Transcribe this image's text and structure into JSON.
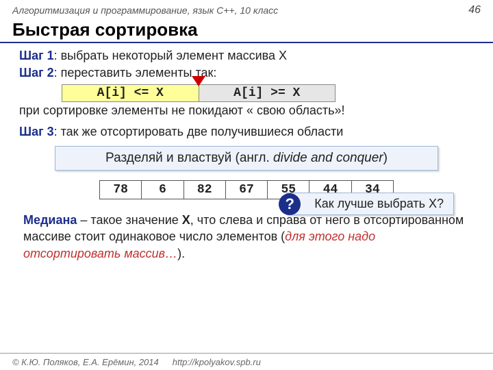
{
  "header": {
    "course": "Алгоритмизация и программирование, язык C++, 10 класс",
    "page": "46"
  },
  "title": "Быстрая сортировка",
  "step1": {
    "label": "Шаг 1",
    "text": ": выбрать некоторый элемент массива X"
  },
  "step2": {
    "label": "Шаг 2",
    "text": ": переставить элементы так:"
  },
  "partition": {
    "left": "A[i] <= X",
    "right": "A[i] >= X"
  },
  "note": "при сортировке элементы не покидают « свою область»!",
  "step3": {
    "label": "Шаг 3",
    "text": ": так же отсортировать две получившиеся области"
  },
  "divide": {
    "ru": "Разделяй и властвуй (англ. ",
    "en": "divide and conquer",
    "close": ")"
  },
  "array": [
    "78",
    "6",
    "82",
    "67",
    "55",
    "44",
    "34"
  ],
  "callout": {
    "q": "?",
    "text": "Как лучше выбрать X?"
  },
  "median": {
    "label": "Медиана",
    "text1": " – такое значение ",
    "x": "X",
    "text2": ", что слева и справа от него в отсортированном массиве стоит одинаковое число элементов (",
    "paren": "для этого надо отсортировать массив…",
    "text3": ")."
  },
  "footer": {
    "copyright": "© К.Ю. Поляков, Е.А. Ерёмин, 2014",
    "url": "http://kpolyakov.spb.ru"
  }
}
